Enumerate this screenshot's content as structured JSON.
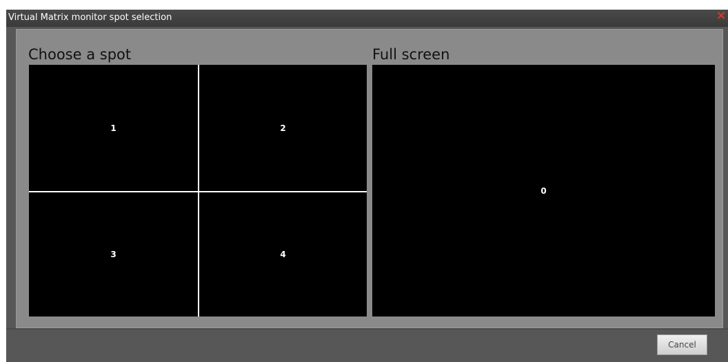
{
  "window": {
    "title": "Virtual Matrix monitor spot selection",
    "close_glyph": "×"
  },
  "choose": {
    "label": "Choose a spot",
    "spots": [
      "1",
      "2",
      "3",
      "4"
    ]
  },
  "fullscreen": {
    "label": "Full screen",
    "spot": "0"
  },
  "footer": {
    "cancel_label": "Cancel"
  },
  "colors": {
    "window_bg": "#575757",
    "titlebar": "#3f3f3f",
    "content_bg": "#8a8a8a",
    "close": "#d23a2a",
    "monitor_bg": "#000000",
    "divider": "#ffffff"
  }
}
